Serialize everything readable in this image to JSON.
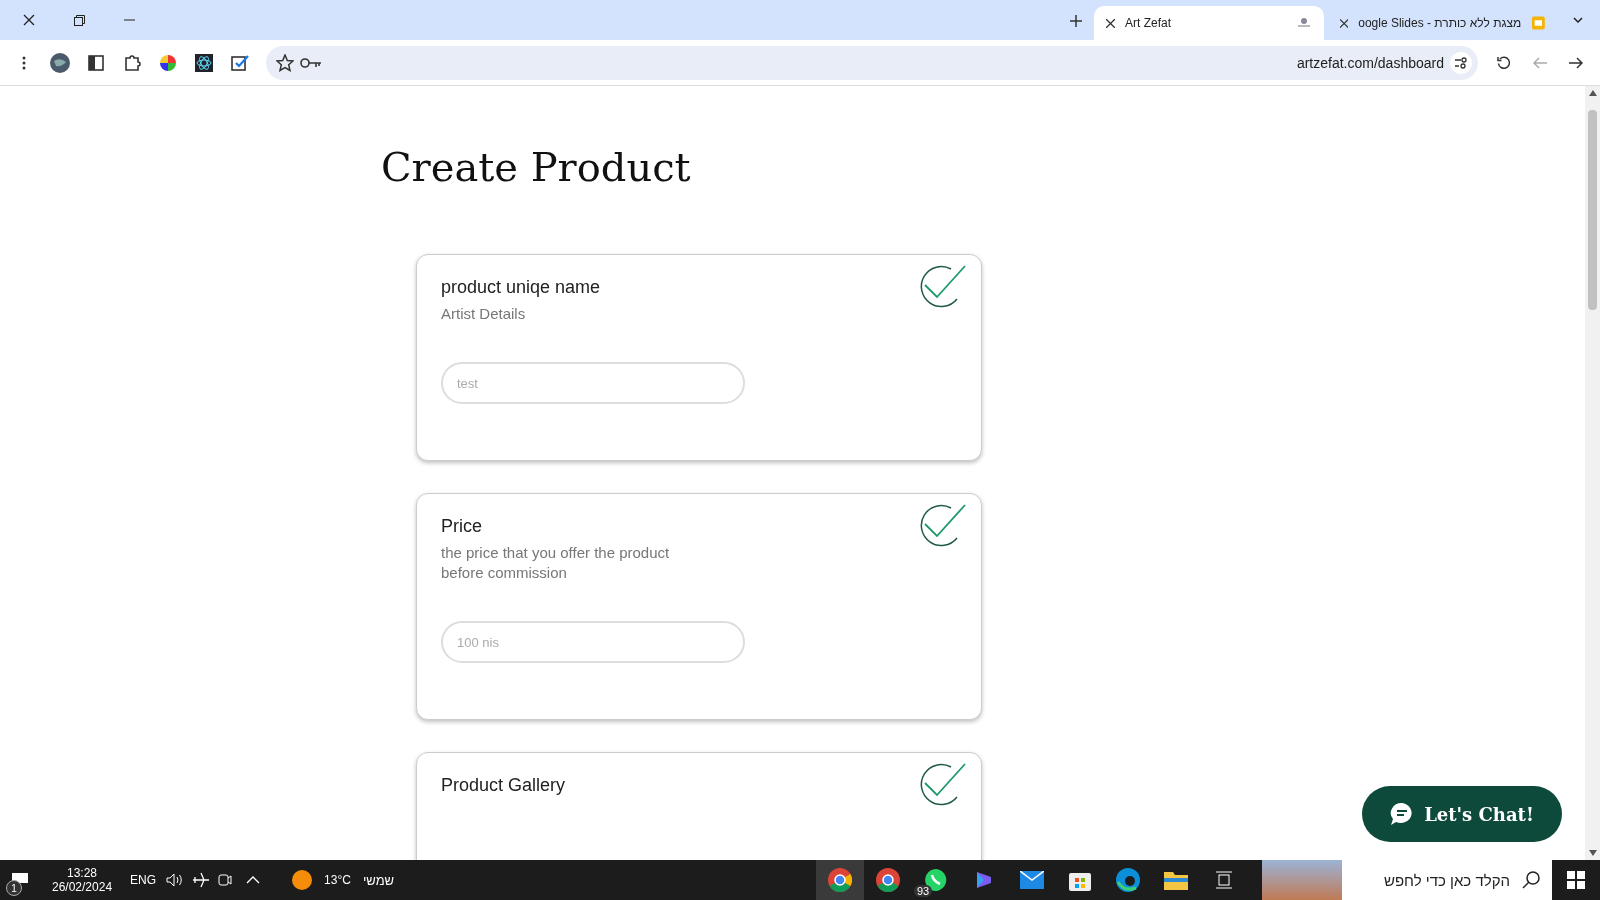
{
  "browser": {
    "tabs": [
      {
        "title": "Art Zefat",
        "selected": true
      },
      {
        "title": "מצגת ללא כותרת - oogle Slides",
        "selected": false
      }
    ],
    "address": "artzefat.com/dashboard"
  },
  "page": {
    "title": "Create Product",
    "cards": [
      {
        "kind": "text",
        "title": "product uniqe name",
        "description": "Artist Details",
        "placeholder": "test",
        "checked": true
      },
      {
        "kind": "text",
        "title": "Price",
        "description": "the price that you offer the product before commission",
        "placeholder": "100 nis",
        "checked": true
      },
      {
        "kind": "gallery",
        "title": "Product Gallery",
        "checked": true
      }
    ],
    "chat_button": "Let's Chat!"
  },
  "taskbar": {
    "notifications": "1",
    "time": "13:28",
    "date": "26/02/2024",
    "language": "ENG",
    "temperature": "13°C",
    "weather": "שמשי",
    "whatsapp_badge": "93",
    "search_placeholder": "הקלד כאן כדי לחפש"
  }
}
